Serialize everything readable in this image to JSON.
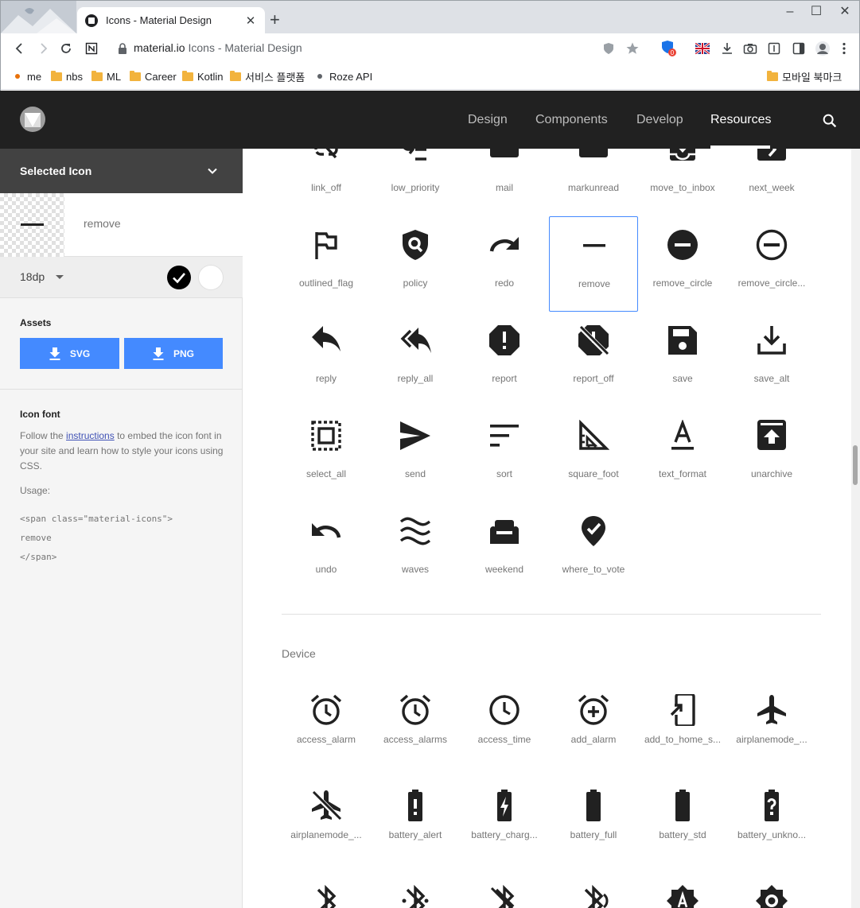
{
  "browser": {
    "tab_title": "Icons - Material Design",
    "url_host": "material.io",
    "url_rest": "Icons - Material Design",
    "extension_badge": "0",
    "bookmarks": [
      {
        "label": "me",
        "kind": "dot",
        "color": "#e8710a"
      },
      {
        "label": "nbs",
        "kind": "folder"
      },
      {
        "label": "ML",
        "kind": "folder"
      },
      {
        "label": "Career",
        "kind": "folder"
      },
      {
        "label": "Kotlin",
        "kind": "folder"
      },
      {
        "label": "서비스 플랫폼",
        "kind": "folder"
      },
      {
        "label": "Roze API",
        "kind": "dot",
        "color": "#5f6368"
      }
    ],
    "mobile_bookmarks": "모바일 북마크"
  },
  "site": {
    "nav": [
      "Design",
      "Components",
      "Develop",
      "Resources"
    ],
    "active_nav": "Resources"
  },
  "sidebar": {
    "header": "Selected Icon",
    "selected_name": "remove",
    "size": "18dp",
    "swatch_dark": "#000000",
    "swatch_light": "#ffffff",
    "assets_label": "Assets",
    "svg_button": "SVG",
    "png_button": "PNG",
    "accent": "#448aff",
    "icon_font_label": "Icon font",
    "instructions_pre": "Follow the ",
    "instructions_link": "instructions",
    "instructions_post": " to embed the icon font in your site and learn how to style your icons using CSS.",
    "usage_label": "Usage:",
    "code_line1": "<span class=\"material-icons\">",
    "code_line2": "remove",
    "code_line3": "</span>"
  },
  "main": {
    "content_rows": [
      [
        "link_off",
        "low_priority",
        "mail",
        "markunread",
        "move_to_inbox",
        "next_week"
      ],
      [
        "outlined_flag",
        "policy",
        "redo",
        "remove",
        "remove_circle",
        "remove_circle..."
      ],
      [
        "reply",
        "reply_all",
        "report",
        "report_off",
        "save",
        "save_alt"
      ],
      [
        "select_all",
        "send",
        "sort",
        "square_foot",
        "text_format",
        "unarchive"
      ],
      [
        "undo",
        "waves",
        "weekend",
        "where_to_vote"
      ]
    ],
    "selected_icon": "remove",
    "device_title": "Device",
    "device_rows": [
      [
        "access_alarm",
        "access_alarms",
        "access_time",
        "add_alarm",
        "add_to_home_s...",
        "airplanemode_..."
      ],
      [
        "airplanemode_...",
        "battery_alert",
        "battery_charg...",
        "battery_full",
        "battery_std",
        "battery_unkno..."
      ]
    ]
  }
}
